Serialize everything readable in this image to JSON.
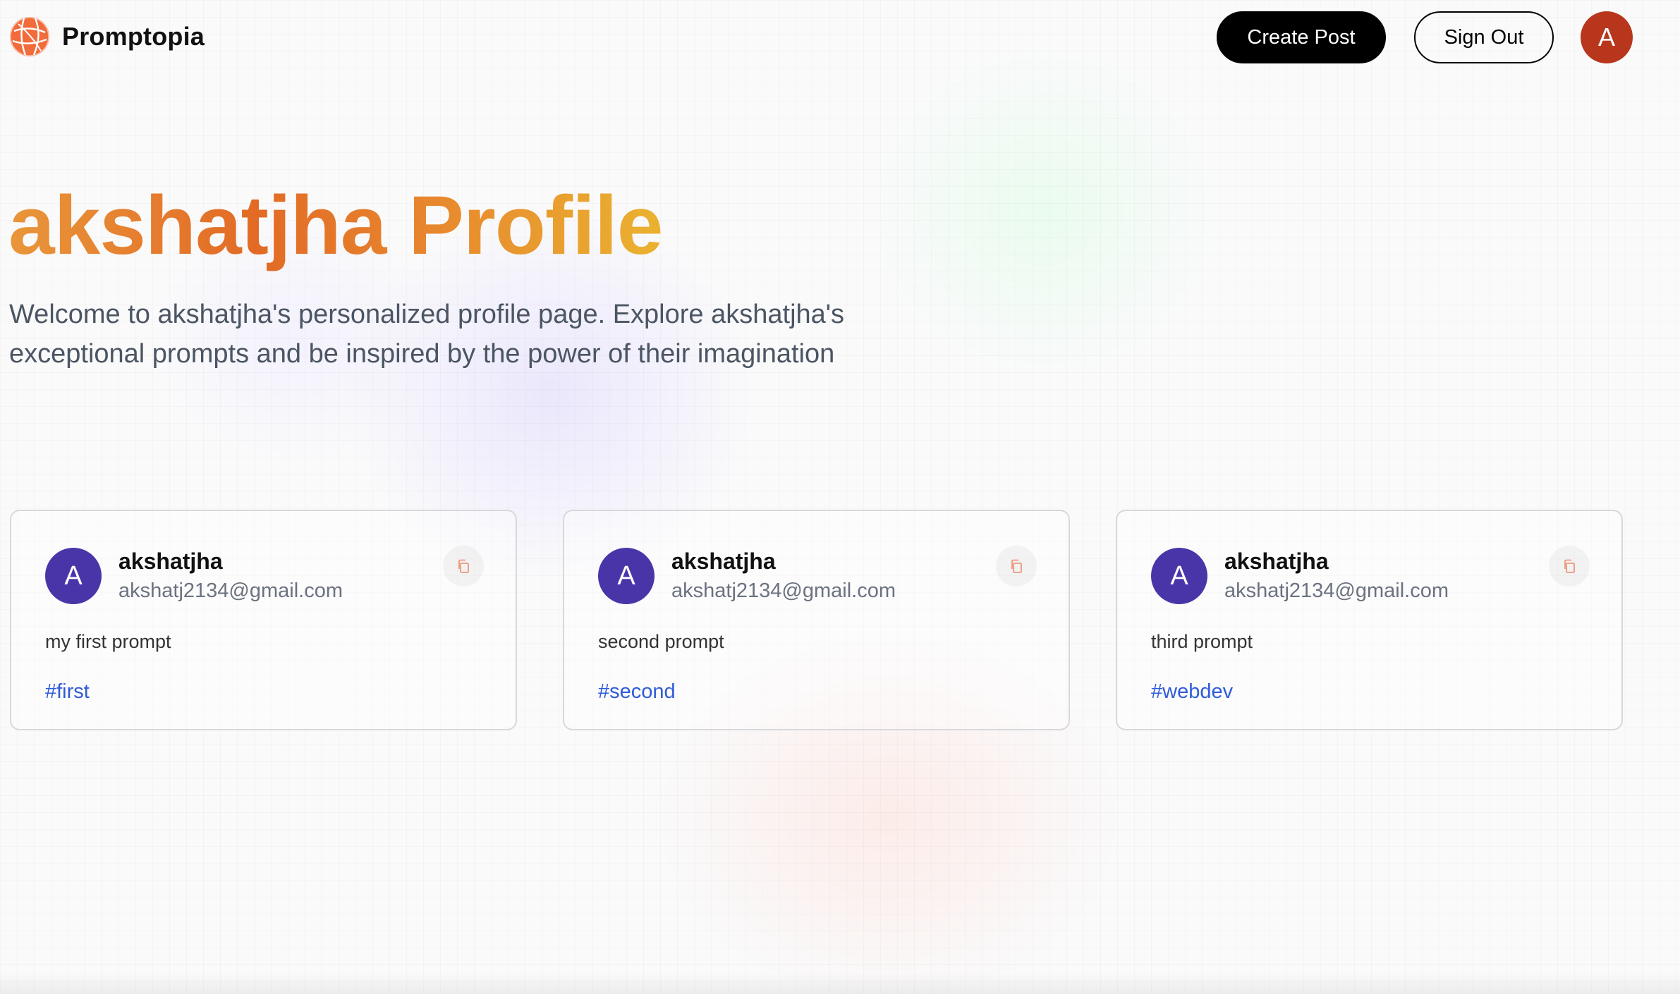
{
  "nav": {
    "brand": "Promptopia",
    "create_post": "Create Post",
    "sign_out": "Sign Out",
    "avatar_letter": "A"
  },
  "profile": {
    "title": "akshatjha Profile",
    "description": "Welcome to akshatjha's personalized profile page. Explore akshatjha's exceptional prompts and be inspired by the power of their imagination"
  },
  "posts": [
    {
      "avatar_letter": "A",
      "username": "akshatjha",
      "email": "akshatj2134@gmail.com",
      "prompt": "my first prompt",
      "tag": "#first"
    },
    {
      "avatar_letter": "A",
      "username": "akshatjha",
      "email": "akshatj2134@gmail.com",
      "prompt": "second prompt",
      "tag": "#second"
    },
    {
      "avatar_letter": "A",
      "username": "akshatjha",
      "email": "akshatj2134@gmail.com",
      "prompt": "third prompt",
      "tag": "#webdev"
    }
  ],
  "icons": {
    "logo": "globe-logo-icon",
    "copy": "copy-icon"
  },
  "colors": {
    "accent_orange": "#e26a25",
    "gradient_start": "#e9963a",
    "gradient_end": "#eab230",
    "nav_avatar": "#b8361c",
    "card_avatar": "#4a35a8",
    "tag_blue": "#2f5bd8",
    "copy_icon": "#ec8a6a"
  }
}
